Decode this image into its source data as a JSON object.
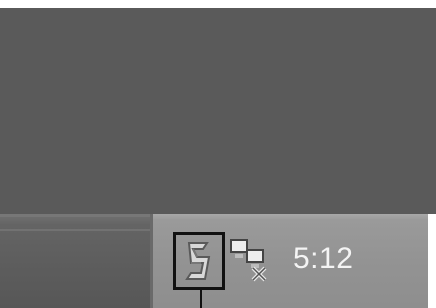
{
  "desktop": {
    "background_color": "#5a5a5a"
  },
  "taskbar": {
    "color": "#6f6f6f"
  },
  "tray": {
    "icons": [
      {
        "name": "app-tray-icon",
        "highlighted": true
      },
      {
        "name": "network-connection-icon",
        "highlighted": false
      }
    ],
    "clock": "5:12"
  }
}
